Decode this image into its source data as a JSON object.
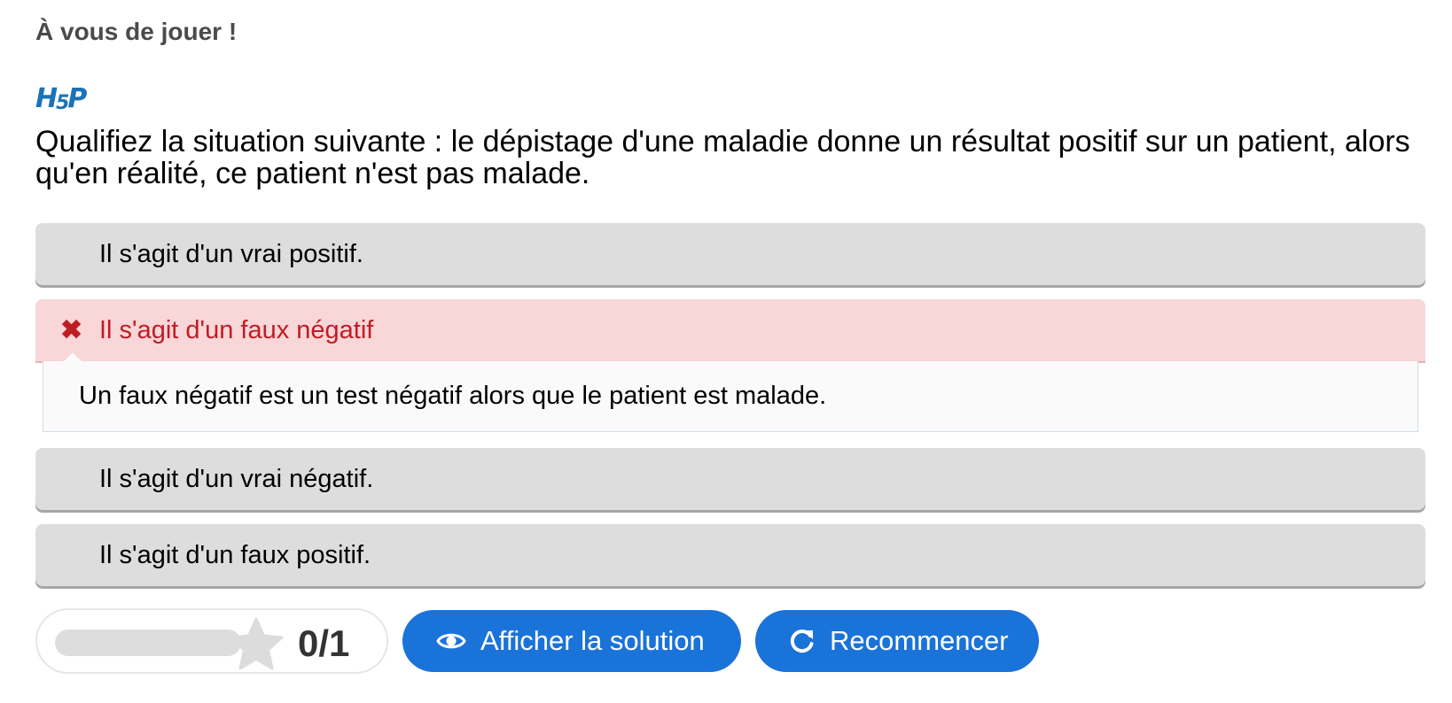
{
  "page": {
    "heading": "À vous de jouer !",
    "logo_text": [
      "H",
      "5",
      "P"
    ]
  },
  "question": {
    "text": "Qualifiez la situation suivante : le dépistage d'une maladie donne un résultat positif sur un patient, alors qu'en réalité, ce patient n'est pas malade."
  },
  "answers": [
    {
      "label": "Il s'agit d'un vrai positif.",
      "state": "neutral"
    },
    {
      "label": "Il s'agit d'un faux négatif",
      "state": "wrong",
      "mark_icon": "cross-icon",
      "feedback": "Un faux négatif est un test négatif alors que le patient est malade."
    },
    {
      "label": "Il s'agit d'un vrai négatif.",
      "state": "neutral"
    },
    {
      "label": "Il s'agit d'un faux positif.",
      "state": "neutral"
    }
  ],
  "score": {
    "text": "0/1",
    "fraction": 0,
    "icon": "star-icon"
  },
  "buttons": {
    "show_solution": {
      "label": "Afficher la solution",
      "icon": "eye-icon"
    },
    "retry": {
      "label": "Recommencer",
      "icon": "retry-icon"
    }
  },
  "colors": {
    "accent": "#1a73d9",
    "wrong_bg": "#f9d6d8",
    "wrong_text": "#bf1d24",
    "answer_bg": "#dddddd"
  }
}
